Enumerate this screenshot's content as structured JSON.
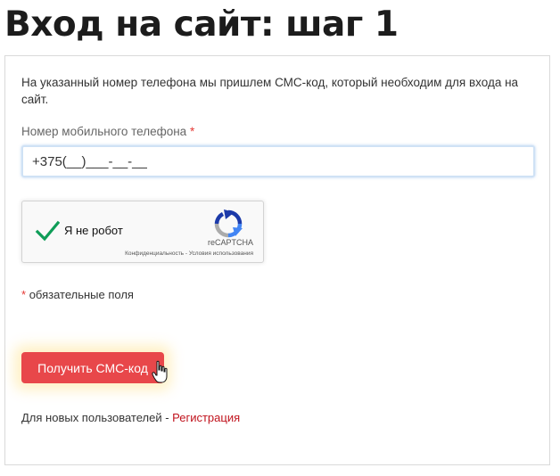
{
  "page": {
    "title": "Вход на сайт: шаг 1"
  },
  "form": {
    "intro": "На указанный номер телефона мы пришлем СМС-код, который необходим для входа на сайт.",
    "phone_label": "Номер мобильного телефона",
    "required_mark": "*",
    "phone_value": "+375(__)___-__-__",
    "required_note": "обязательные поля",
    "submit_label": "Получить СМС-код",
    "new_users_text": "Для новых пользователей - ",
    "register_link": "Регистрация"
  },
  "captcha": {
    "label": "Я не робот",
    "brand": "reCAPTCHA",
    "privacy": "Конфиденциальность",
    "separator": " - ",
    "terms": "Условия использования",
    "checked": true
  },
  "colors": {
    "accent": "#e8474a",
    "link": "#c0121c",
    "required": "#e53935",
    "check": "#0f9d58"
  }
}
